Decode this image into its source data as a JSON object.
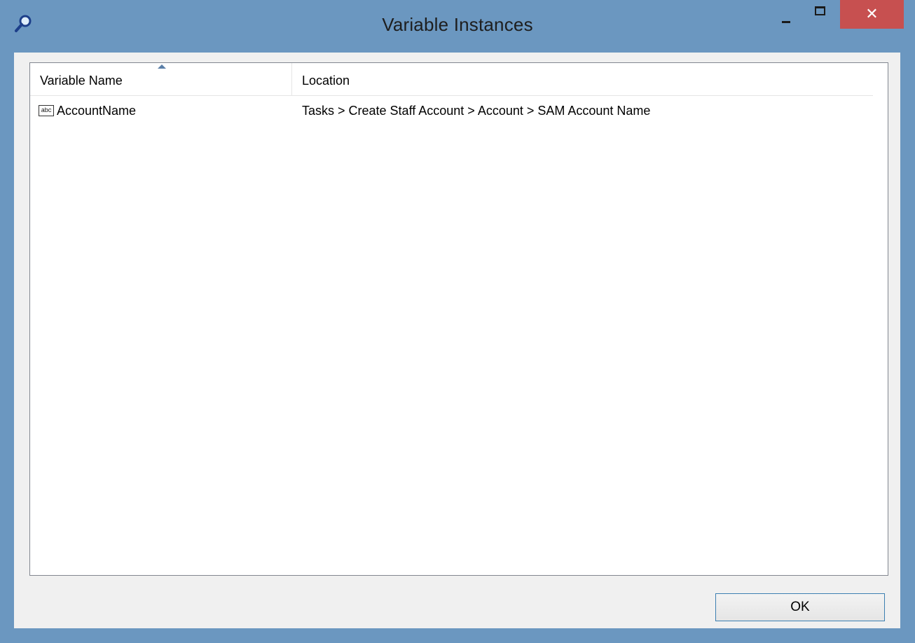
{
  "window": {
    "title": "Variable Instances",
    "icon": "magnifier-icon",
    "controls": {
      "minimize": "minimize-icon",
      "maximize": "maximize-icon",
      "close_label": "✕"
    }
  },
  "list": {
    "columns": {
      "name": "Variable Name",
      "location": "Location"
    },
    "sorted_by": "Variable Name",
    "sort_direction": "ascending",
    "rows": [
      {
        "icon": "abc",
        "name": "AccountName",
        "location": "Tasks > Create Staff Account > Account > SAM Account Name"
      }
    ]
  },
  "footer": {
    "ok_label": "OK"
  },
  "colors": {
    "frame": "#6b97c0",
    "close_button": "#c75050",
    "client_background": "#f0f0f0"
  }
}
